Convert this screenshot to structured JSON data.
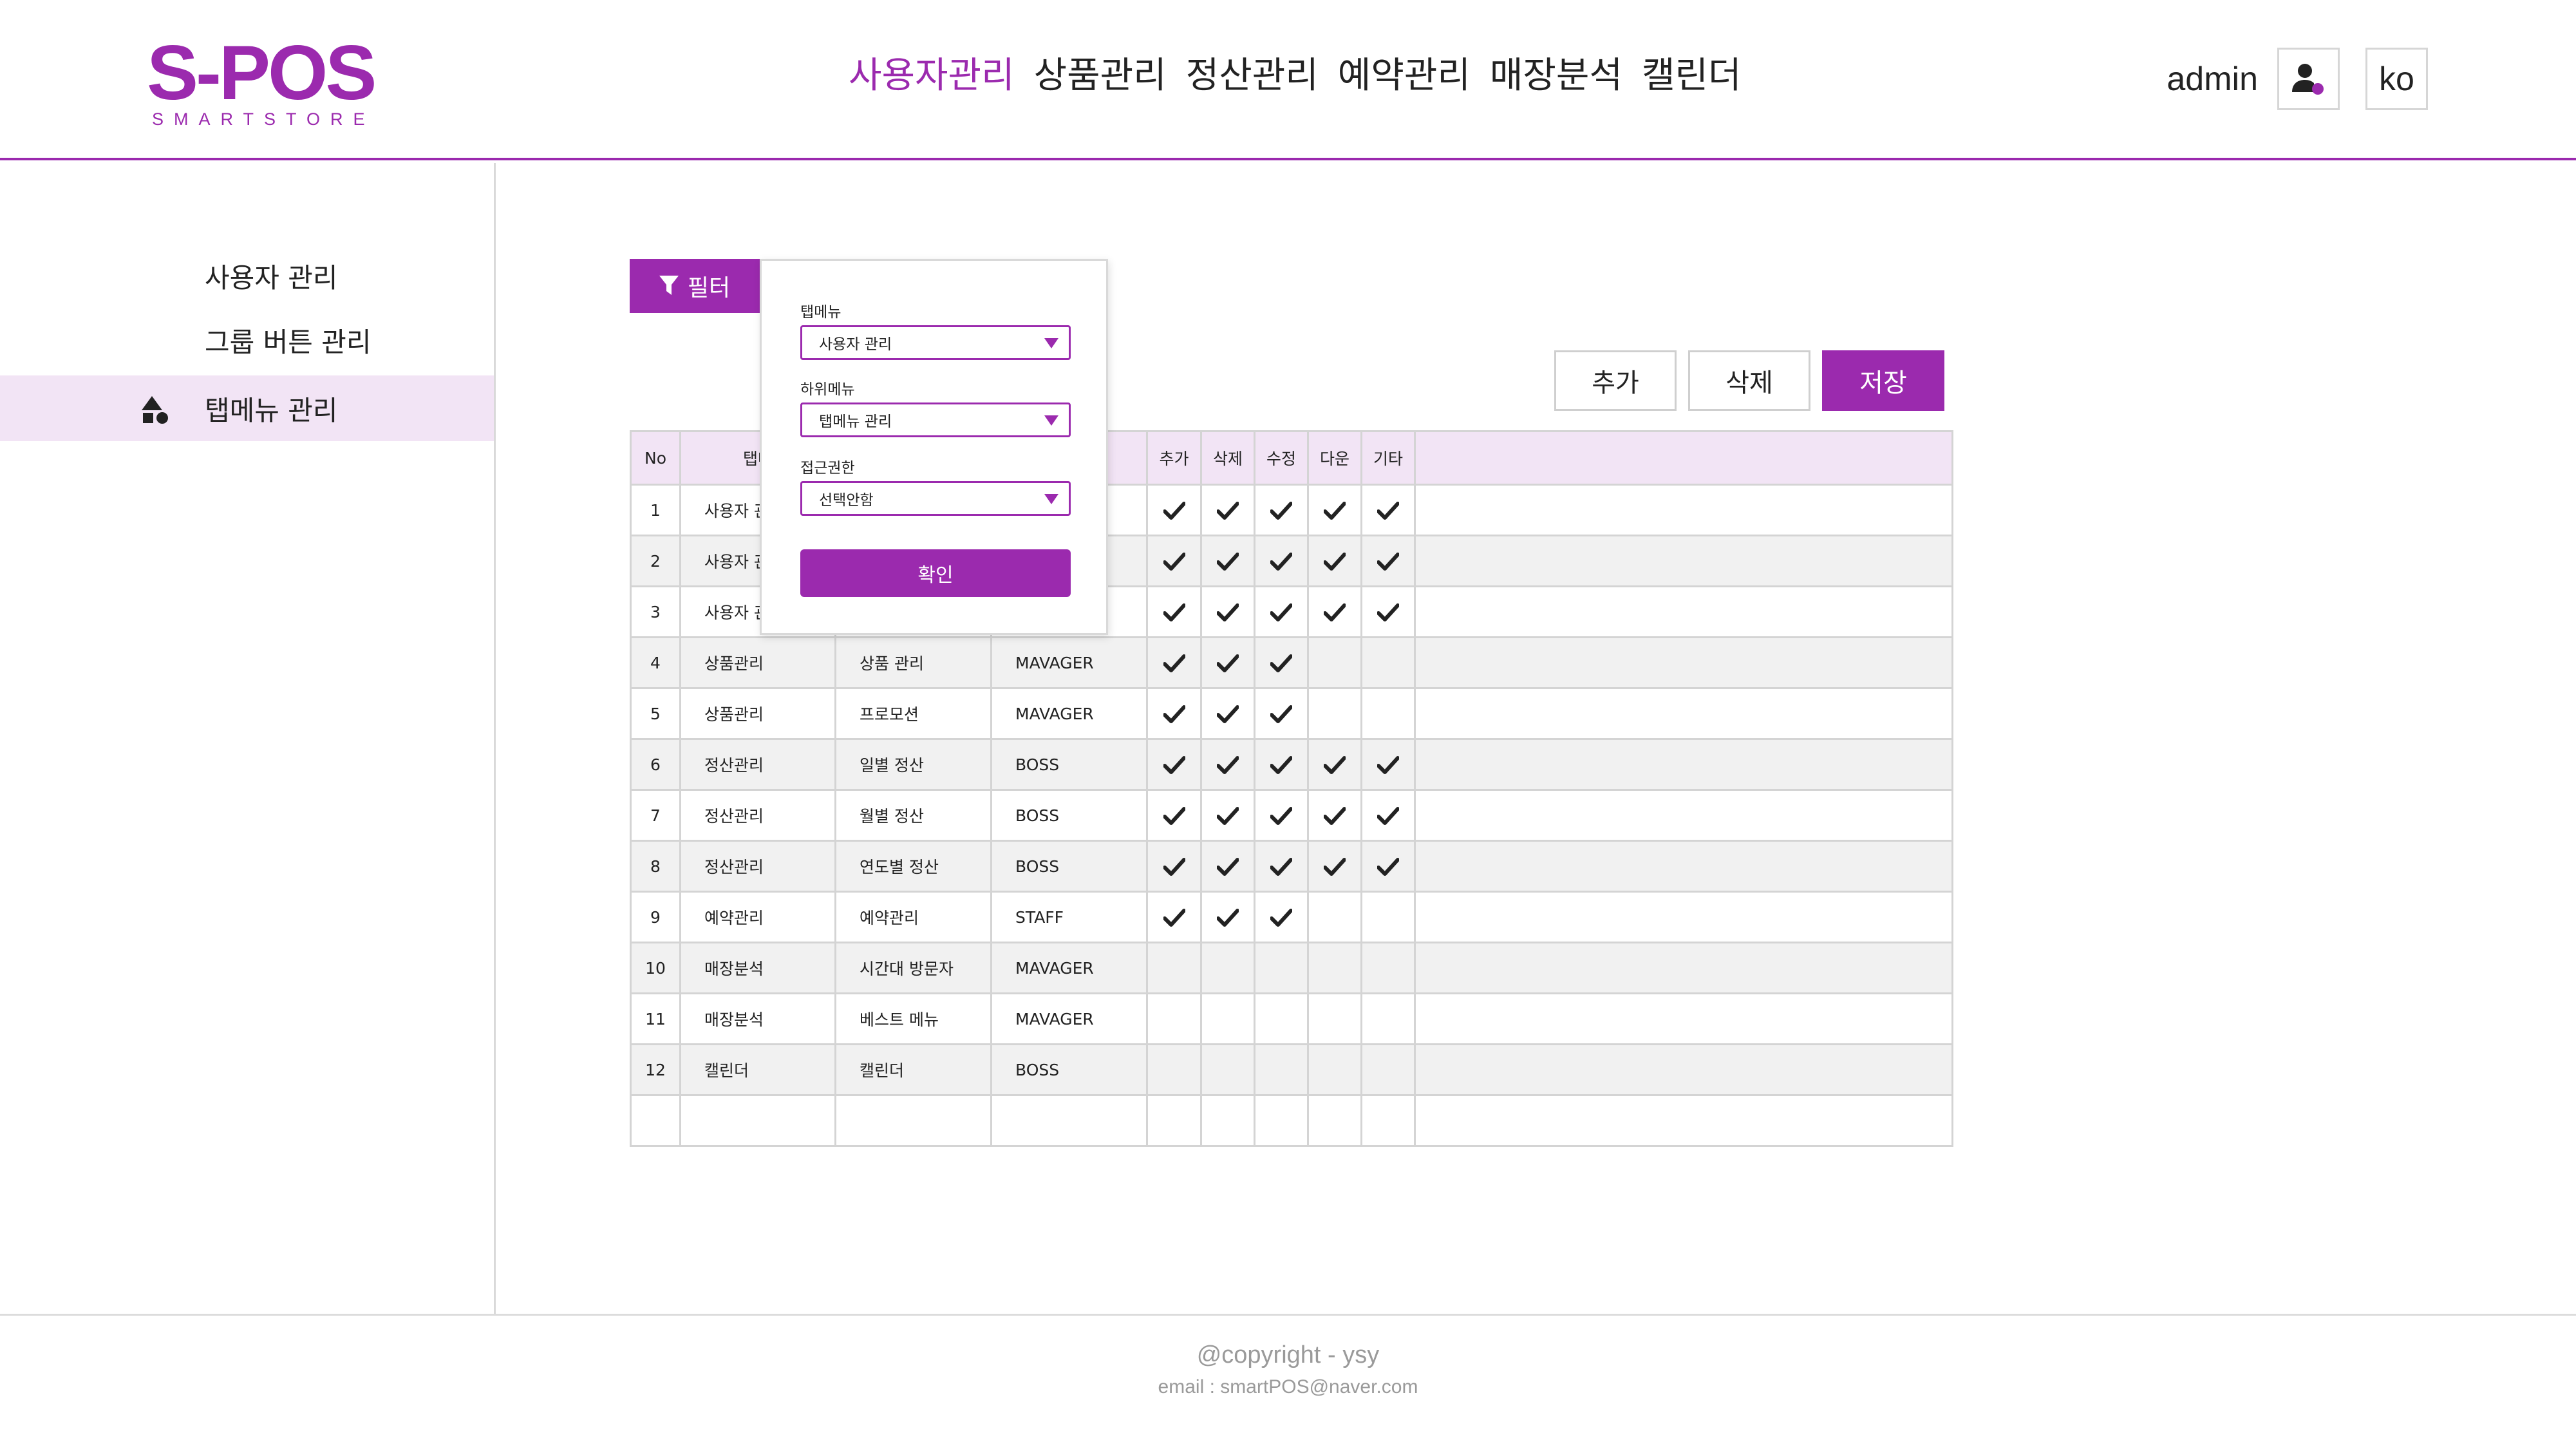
{
  "colors": {
    "accent": "#9b2aae",
    "accent_light": "#f2e4f5",
    "row_alt": "#f1f1f1",
    "border": "#d4d4d4"
  },
  "header": {
    "logo_main": "S-POS",
    "logo_sub": "SMARTSTORE",
    "nav": [
      "사용자관리",
      "상품관리",
      "정산관리",
      "예약관리",
      "매장분석",
      "캘린더"
    ],
    "active_nav": "사용자관리",
    "username": "admin",
    "user_icon": "user-settings-icon",
    "language": "ko"
  },
  "sidebar": {
    "items": [
      {
        "label": "사용자 관리"
      },
      {
        "label": "그룹 버튼 관리"
      },
      {
        "label": "탭메뉴 관리",
        "icon": "shapes-icon",
        "active": true
      }
    ]
  },
  "toolbar": {
    "filter_label": "필터",
    "filter_icon": "filter-icon",
    "add_label": "추가",
    "delete_label": "삭제",
    "save_label": "저장"
  },
  "table": {
    "headers": [
      "No",
      "탭메",
      "",
      "",
      "추가",
      "삭제",
      "수정",
      "다운",
      "기타",
      ""
    ],
    "rows": [
      {
        "no": "1",
        "tab": "사용자 관",
        "sub": "",
        "role": "",
        "perms": [
          true,
          true,
          true,
          true,
          true
        ]
      },
      {
        "no": "2",
        "tab": "사용자 관",
        "sub": "",
        "role": "",
        "perms": [
          true,
          true,
          true,
          true,
          true
        ]
      },
      {
        "no": "3",
        "tab": "사용자 관",
        "sub": "",
        "role": "",
        "perms": [
          true,
          true,
          true,
          true,
          true
        ]
      },
      {
        "no": "4",
        "tab": "상품관리",
        "sub": "상품 관리",
        "role": "MAVAGER",
        "perms": [
          true,
          true,
          true,
          false,
          false
        ]
      },
      {
        "no": "5",
        "tab": "상품관리",
        "sub": "프로모션",
        "role": "MAVAGER",
        "perms": [
          true,
          true,
          true,
          false,
          false
        ]
      },
      {
        "no": "6",
        "tab": "정산관리",
        "sub": "일별 정산",
        "role": "BOSS",
        "perms": [
          true,
          true,
          true,
          true,
          true
        ]
      },
      {
        "no": "7",
        "tab": "정산관리",
        "sub": "월별 정산",
        "role": "BOSS",
        "perms": [
          true,
          true,
          true,
          true,
          true
        ]
      },
      {
        "no": "8",
        "tab": "정산관리",
        "sub": "연도별 정산",
        "role": "BOSS",
        "perms": [
          true,
          true,
          true,
          true,
          true
        ]
      },
      {
        "no": "9",
        "tab": "예약관리",
        "sub": "예약관리",
        "role": "STAFF",
        "perms": [
          true,
          true,
          true,
          false,
          false
        ]
      },
      {
        "no": "10",
        "tab": "매장분석",
        "sub": "시간대 방문자",
        "role": "MAVAGER",
        "perms": [
          false,
          false,
          false,
          false,
          false
        ]
      },
      {
        "no": "11",
        "tab": "매장분석",
        "sub": "베스트 메뉴",
        "role": "MAVAGER",
        "perms": [
          false,
          false,
          false,
          false,
          false
        ]
      },
      {
        "no": "12",
        "tab": "캘린더",
        "sub": "캘린더",
        "role": "BOSS",
        "perms": [
          false,
          false,
          false,
          false,
          false
        ]
      },
      {
        "no": "",
        "tab": "",
        "sub": "",
        "role": "",
        "perms": [
          false,
          false,
          false,
          false,
          false
        ]
      }
    ]
  },
  "filter_popup": {
    "tab_menu_label": "탭메뉴",
    "tab_menu_value": "사용자 관리",
    "sub_menu_label": "하위메뉴",
    "sub_menu_value": "탭메뉴 관리",
    "access_label": "접근권한",
    "access_value": "선택안함",
    "confirm_label": "확인"
  },
  "footer": {
    "copyright": "@copyright - ysy",
    "email": "email : smartPOS@naver.com"
  }
}
